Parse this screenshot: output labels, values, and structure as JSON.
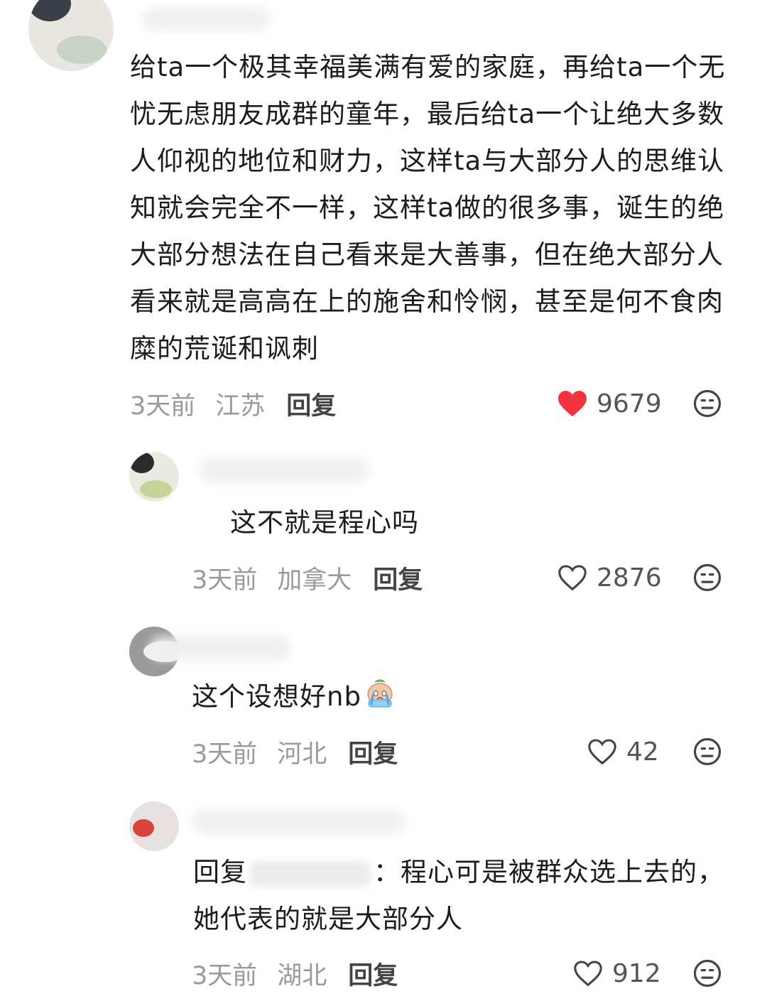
{
  "comments": [
    {
      "text": "给ta一个极其幸福美满有爱的家庭，再给ta一个无忧无虑朋友成群的童年，最后给ta一个让绝大多数人仰视的地位和财力，这样ta与大部分人的思维认知就会完全不一样，这样ta做的很多事，诞生的绝大部分想法在自己看来是大善事，但在绝大部分人看来就是高高在上的施舍和怜悯，甚至是何不食肉糜的荒诞和讽刺",
      "time": "3天前",
      "location": "江苏",
      "reply_label": "回复",
      "likes": "9679",
      "liked": true
    },
    {
      "text": "这不就是程心吗",
      "time": "3天前",
      "location": "加拿大",
      "reply_label": "回复",
      "likes": "2876",
      "liked": false
    },
    {
      "text": "这个设想好nb",
      "emoji": "crying-face-emoji",
      "time": "3天前",
      "location": "河北",
      "reply_label": "回复",
      "likes": "42",
      "liked": false
    },
    {
      "reply_prefix": "回复",
      "text": "：程心可是被群众选上去的，她代表的就是大部分人",
      "time": "3天前",
      "location": "湖北",
      "reply_label": "回复",
      "likes": "912",
      "liked": false
    }
  ],
  "colors": {
    "liked_heart": "#f5333f",
    "meta_text": "#9a9a9a",
    "body_text": "#1c1c1c"
  },
  "icons": {
    "like": "heart-icon",
    "dislike": "meh-face-icon"
  }
}
